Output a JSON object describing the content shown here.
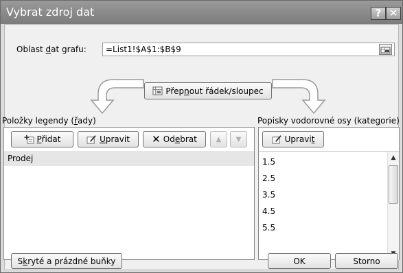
{
  "window": {
    "title": "Vybrat zdroj dat"
  },
  "range": {
    "label_pre": "Oblast ",
    "label_acc": "d",
    "label_post": "at grafu:",
    "value": "=List1!$A$1:$B$9"
  },
  "switch": {
    "pre": "Přep",
    "acc": "n",
    "post": "out řádek/sloupec"
  },
  "legend": {
    "label_pre": "Položky legendy (",
    "label_acc": "ř",
    "label_post": "ady)",
    "add": {
      "pre": "",
      "acc": "P",
      "post": "řidat"
    },
    "edit": {
      "pre": "",
      "acc": "U",
      "post": "pravit"
    },
    "remove": {
      "pre": "Od",
      "acc": "e",
      "post": "brat"
    },
    "items": [
      "Prodej"
    ]
  },
  "axis": {
    "label_pre": "Popisky vodorovné osy (kate",
    "label_acc": "g",
    "label_post": "orie)",
    "edit": {
      "pre": "Upravi",
      "acc": "t",
      "post": ""
    },
    "items": [
      "1.5",
      "2.5",
      "3.5",
      "4.5",
      "5.5"
    ]
  },
  "hidden_cells": {
    "pre": "S",
    "acc": "k",
    "post": "ryté a prázdné buňky"
  },
  "ok": "OK",
  "cancel": "Storno",
  "colors": {
    "selection": "#e6e6e6",
    "titlebar": "#8a8a8a"
  }
}
